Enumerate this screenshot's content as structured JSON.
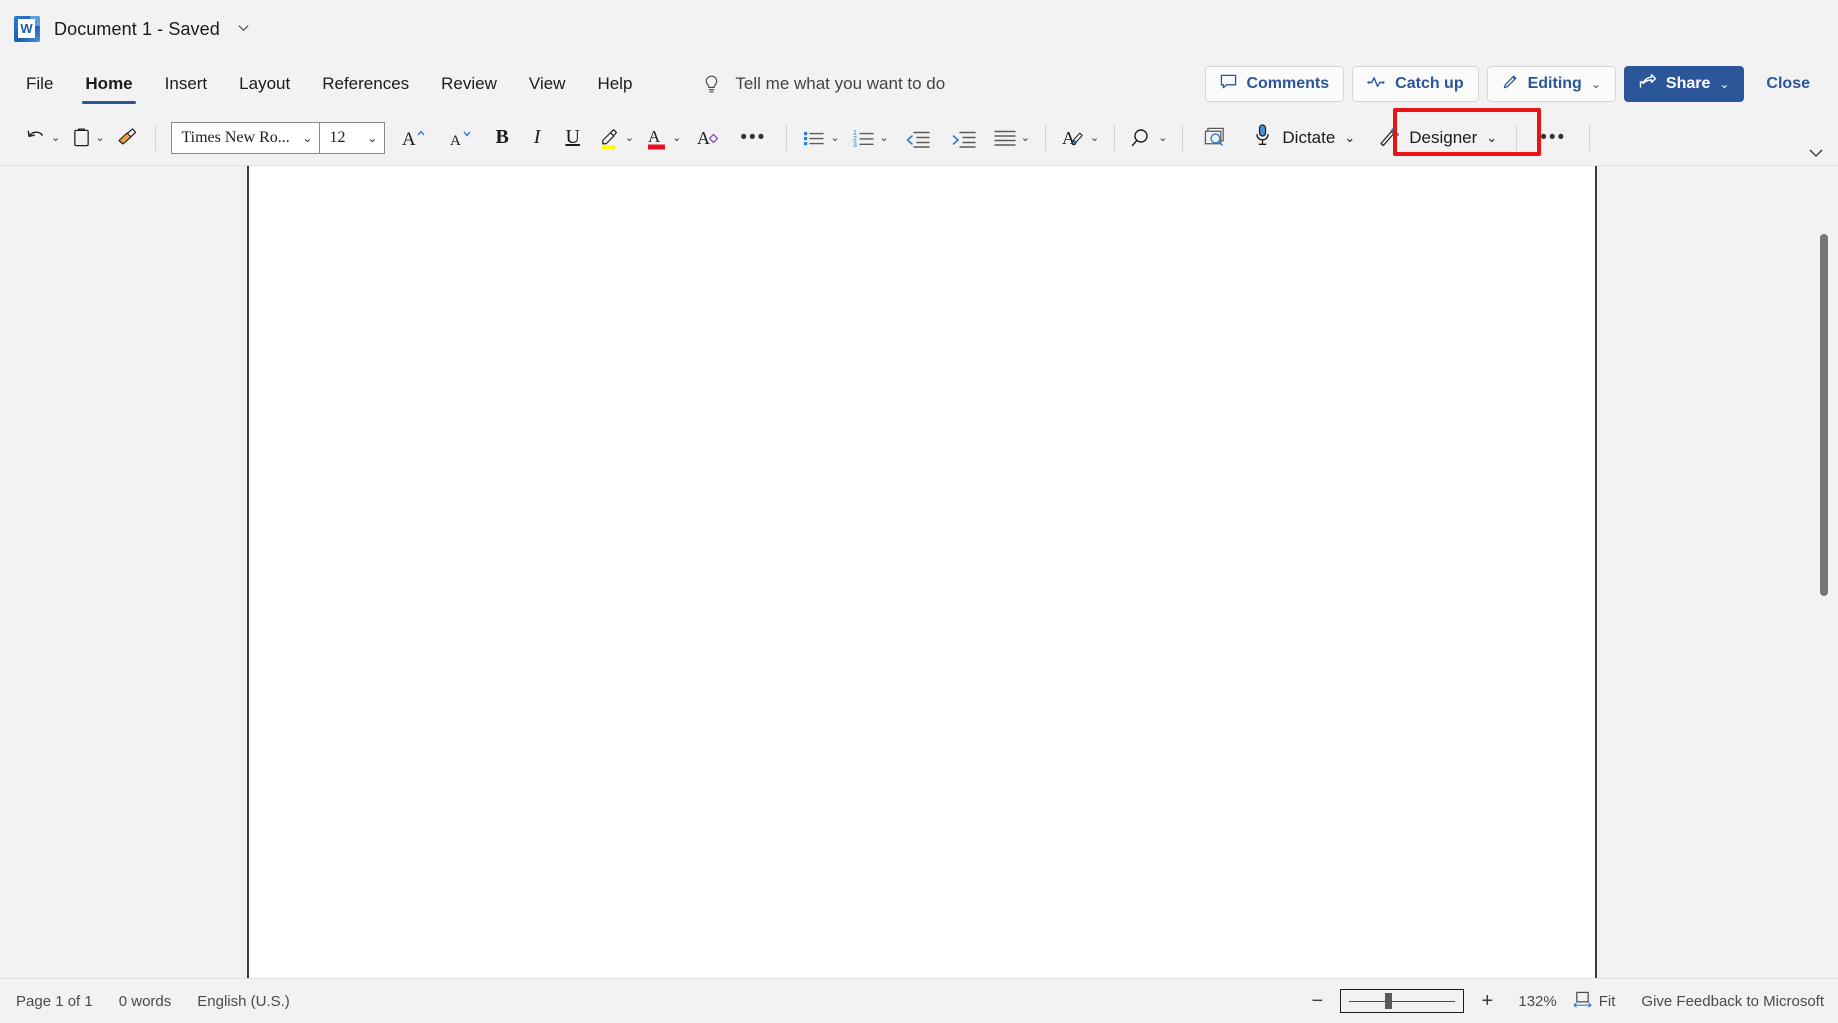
{
  "titlebar": {
    "logo_icon": "word-logo-icon",
    "document_name": "Document 1  -  Saved",
    "chevron_icon": "chevron-down-icon"
  },
  "tabs": [
    {
      "label": "File",
      "active": false
    },
    {
      "label": "Home",
      "active": true
    },
    {
      "label": "Insert",
      "active": false
    },
    {
      "label": "Layout",
      "active": false
    },
    {
      "label": "References",
      "active": false
    },
    {
      "label": "Review",
      "active": false
    },
    {
      "label": "View",
      "active": false
    },
    {
      "label": "Help",
      "active": false
    }
  ],
  "tellme": {
    "icon": "lightbulb-icon",
    "label": "Tell me what you want to do"
  },
  "commands": {
    "comments": {
      "label": "Comments",
      "icon": "comment-icon"
    },
    "catch_up": {
      "label": "Catch up",
      "icon": "activity-line-icon"
    },
    "editing": {
      "label": "Editing",
      "icon": "pencil-icon",
      "chevron": "⌄"
    },
    "share": {
      "label": "Share",
      "icon": "share-icon",
      "chevron": "⌄"
    },
    "close": {
      "label": "Close"
    }
  },
  "ribbon": {
    "undo": {
      "icon": "undo-icon",
      "chevron": "⌄"
    },
    "paste": {
      "icon": "clipboard-paste-icon",
      "chevron": "⌄"
    },
    "format_painter": {
      "icon": "format-painter-icon"
    },
    "font_name": {
      "value": "Times New Ro...",
      "chevron": "⌄"
    },
    "font_size": {
      "value": "12",
      "chevron": "⌄"
    },
    "grow_font": {
      "icon": "grow-font-icon",
      "label": "A"
    },
    "shrink_font": {
      "icon": "shrink-font-icon",
      "label": "A"
    },
    "bold": {
      "icon": "bold-icon",
      "label": "B"
    },
    "italic": {
      "icon": "italic-icon",
      "label": "I"
    },
    "underline": {
      "icon": "underline-icon",
      "label": "U"
    },
    "highlight": {
      "icon": "text-highlight-icon",
      "color": "#ffff00",
      "chevron": "⌄"
    },
    "font_color": {
      "icon": "font-color-icon",
      "color": "#e81123",
      "chevron": "⌄"
    },
    "clear_formatting": {
      "icon": "clear-formatting-icon"
    },
    "more_font": {
      "icon": "ellipsis-icon"
    },
    "bullets": {
      "icon": "bullet-list-icon",
      "chevron": "⌄"
    },
    "numbering": {
      "icon": "numbered-list-icon",
      "chevron": "⌄"
    },
    "decrease_indent": {
      "icon": "decrease-indent-icon"
    },
    "increase_indent": {
      "icon": "increase-indent-icon"
    },
    "alignment": {
      "icon": "align-icon",
      "chevron": "⌄"
    },
    "styles": {
      "icon": "styles-icon",
      "chevron": "⌄"
    },
    "find": {
      "icon": "search-icon",
      "chevron": "⌄"
    },
    "editor": {
      "icon": "editor-check-icon"
    },
    "dictate": {
      "icon": "microphone-icon",
      "label": "Dictate",
      "chevron": "⌄"
    },
    "designer": {
      "icon": "designer-wand-icon",
      "label": "Designer",
      "chevron": "⌄"
    },
    "overflow": {
      "icon": "ellipsis-icon"
    },
    "collapse": {
      "icon": "chevron-down-icon"
    }
  },
  "highlight": {
    "target": "dictate",
    "color": "#e81313"
  },
  "document": {
    "content": ""
  },
  "scrollbar": {
    "orientation": "vertical"
  },
  "statusbar": {
    "page": "Page 1 of 1",
    "words": "0 words",
    "language": "English (U.S.)",
    "zoom_out_icon": "minus-icon",
    "zoom_in_icon": "plus-icon",
    "zoom_level": "132%",
    "fit_icon": "fit-width-icon",
    "fit_label": "Fit",
    "feedback": "Give Feedback to Microsoft"
  }
}
